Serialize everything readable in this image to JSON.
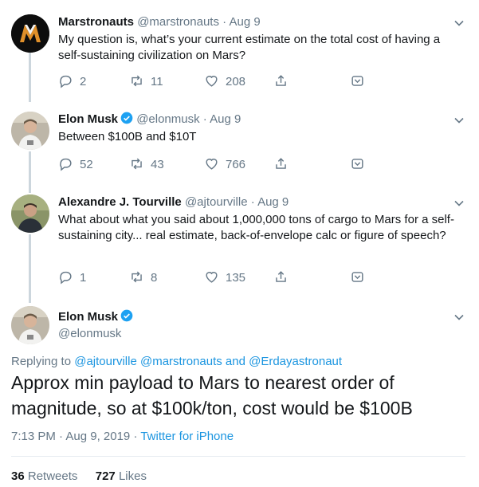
{
  "tweets": [
    {
      "name": "Marstronauts",
      "handle": "@marstronauts",
      "date": "Aug 9",
      "text": "My question is, what’s your current estimate on the total cost of having a self-sustaining civilization on Mars?",
      "replies": "2",
      "retweets": "11",
      "likes": "208",
      "verified": false
    },
    {
      "name": "Elon Musk",
      "handle": "@elonmusk",
      "date": "Aug 9",
      "text": "Between $100B and $10T",
      "replies": "52",
      "retweets": "43",
      "likes": "766",
      "verified": true
    },
    {
      "name": "Alexandre J. Tourville",
      "handle": "@ajtourville",
      "date": "Aug 9",
      "text": "What about what you said about 1,000,000 tons of cargo to Mars for a self-sustaining city... real estimate, back-of-envelope calc or figure of speech?",
      "replies": "1",
      "retweets": "8",
      "likes": "135",
      "verified": false
    }
  ],
  "main_tweet": {
    "name": "Elon Musk",
    "handle": "@elonmusk",
    "replying_prefix": "Replying to ",
    "replying_to": "@ajtourville @marstronauts and @Erdayastronaut",
    "text": "Approx min payload to Mars to nearest order of magnitude, so at $100k/ton, cost would be $100B",
    "time": "7:13 PM · Aug 9, 2019",
    "separator": " · ",
    "source": "Twitter for iPhone",
    "retweets_count": "36",
    "retweets_label": "Retweets",
    "likes_count": "727",
    "likes_label": "Likes"
  },
  "icons": {
    "reply": "reply-icon",
    "retweet": "retweet-icon",
    "like": "heart-icon",
    "share": "share-icon",
    "save": "bookmark-icon",
    "menu": "chevron-down-icon",
    "verified": "verified-badge-icon"
  },
  "colors": {
    "text": "#14171a",
    "muted": "#657786",
    "link": "#1b95e0",
    "verified": "#1da1f2",
    "thread_line": "#ccd6dd"
  }
}
